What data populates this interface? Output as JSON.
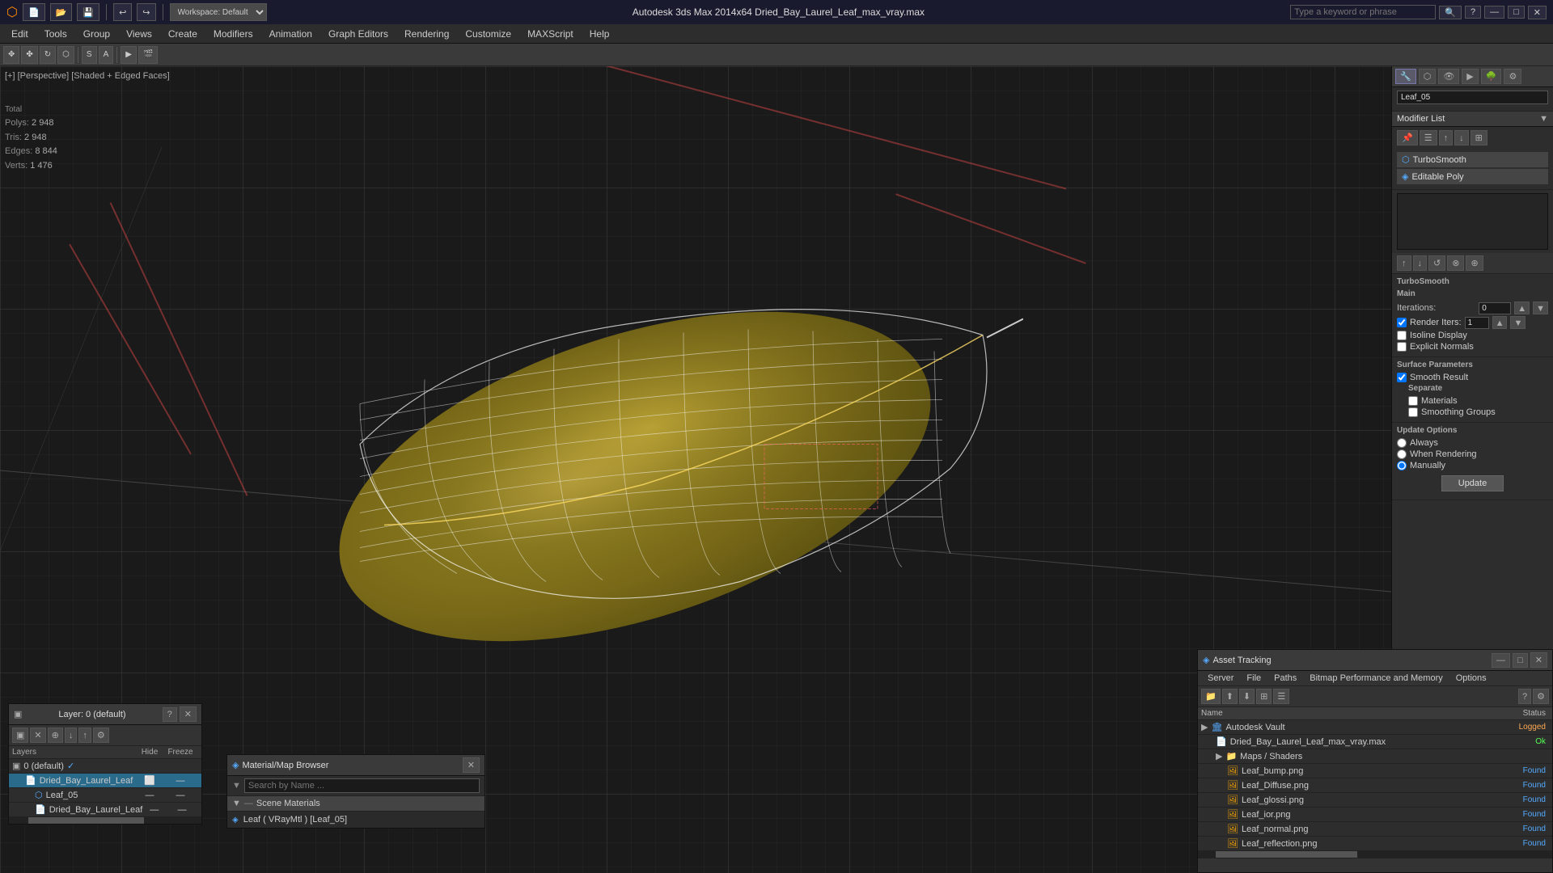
{
  "titlebar": {
    "app_icon": "3ds-max-icon",
    "workspace_label": "Workspace: Default",
    "title": "Autodesk 3ds Max 2014x64    Dried_Bay_Laurel_Leaf_max_vray.max",
    "search_placeholder": "Type a keyword or phrase",
    "min_label": "—",
    "max_label": "□",
    "close_label": "✕"
  },
  "menubar": {
    "items": [
      {
        "label": "Edit",
        "id": "edit"
      },
      {
        "label": "Tools",
        "id": "tools"
      },
      {
        "label": "Group",
        "id": "group"
      },
      {
        "label": "Views",
        "id": "views"
      },
      {
        "label": "Create",
        "id": "create"
      },
      {
        "label": "Modifiers",
        "id": "modifiers"
      },
      {
        "label": "Animation",
        "id": "animation"
      },
      {
        "label": "Graph Editors",
        "id": "graph-editors"
      },
      {
        "label": "Rendering",
        "id": "rendering"
      },
      {
        "label": "Customize",
        "id": "customize"
      },
      {
        "label": "MAXScript",
        "id": "maxscript"
      },
      {
        "label": "Help",
        "id": "help"
      }
    ]
  },
  "viewport": {
    "label": "[+] [Perspective] [Shaded + Edged Faces]",
    "stats": {
      "polys_label": "Polys:",
      "polys_total_label": "Total",
      "polys_val": "2 948",
      "tris_label": "Tris:",
      "tris_val": "2 948",
      "edges_label": "Edges:",
      "edges_val": "8 844",
      "verts_label": "Verts:",
      "verts_val": "1 476"
    }
  },
  "right_panel": {
    "object_name": "Leaf_05",
    "modifier_list_label": "Modifier List",
    "modifiers": [
      {
        "name": "TurboSmooth",
        "active": false
      },
      {
        "name": "Editable Poly",
        "active": false
      }
    ],
    "turbosmooth_label": "TurboSmooth",
    "main_label": "Main",
    "iterations_label": "Iterations:",
    "iterations_val": "0",
    "render_iters_label": "Render Iters:",
    "render_iters_val": "1",
    "isoline_display_label": "Isoline Display",
    "explicit_normals_label": "Explicit Normals",
    "surface_params_label": "Surface Parameters",
    "smooth_result_label": "Smooth Result",
    "separate_label": "Separate",
    "materials_label": "Materials",
    "smoothing_groups_label": "Smoothing Groups",
    "update_options_label": "Update Options",
    "always_label": "Always",
    "when_rendering_label": "When Rendering",
    "manually_label": "Manually",
    "update_btn_label": "Update",
    "icons": {
      "pin": "📌",
      "list": "☰",
      "func1": "↕",
      "func2": "⚙",
      "func3": "⊞"
    }
  },
  "layer_panel": {
    "title": "Layer: 0 (default)",
    "help_icon": "?",
    "close_icon": "✕",
    "columns": {
      "layers_label": "Layers",
      "hide_label": "Hide",
      "freeze_label": "Freeze"
    },
    "rows": [
      {
        "name": "0 (default)",
        "level": 0,
        "selected": false,
        "checkmark": "✓"
      },
      {
        "name": "Dried_Bay_Laurel_Leaf",
        "level": 1,
        "selected": true,
        "checkmark": ""
      },
      {
        "name": "Leaf_05",
        "level": 2,
        "selected": false,
        "checkmark": ""
      },
      {
        "name": "Dried_Bay_Laurel_Leaf",
        "level": 2,
        "selected": false,
        "checkmark": ""
      }
    ]
  },
  "mat_browser": {
    "title": "Material/Map Browser",
    "close_icon": "✕",
    "search_placeholder": "Search by Name ...",
    "scene_materials_label": "Scene Materials",
    "materials": [
      {
        "name": "Leaf ( VRayMtl ) [Leaf_05]",
        "icon": "mat-icon"
      }
    ]
  },
  "asset_tracking": {
    "title": "Asset Tracking",
    "min_icon": "—",
    "restore_icon": "□",
    "close_icon": "✕",
    "menu_items": [
      {
        "label": "Server"
      },
      {
        "label": "File"
      },
      {
        "label": "Paths"
      },
      {
        "label": "Bitmap Performance and Memory"
      }
    ],
    "options_label": "Options",
    "toolbar_icons": [
      "📁",
      "⬆",
      "⬇",
      "🔍",
      "⊞"
    ],
    "columns": {
      "name_label": "Name",
      "status_label": "Status"
    },
    "rows": [
      {
        "name": "Autodesk Vault",
        "level": 0,
        "status": "Logged",
        "status_class": "status-logged",
        "is_group": true
      },
      {
        "name": "Dried_Bay_Laurel_Leaf_max_vray.max",
        "level": 1,
        "status": "Ok",
        "status_class": "status-ok",
        "icon": "file-icon"
      },
      {
        "name": "Maps / Shaders",
        "level": 1,
        "status": "",
        "status_class": "",
        "is_group": true
      },
      {
        "name": "Leaf_bump.png",
        "level": 2,
        "status": "Found",
        "status_class": "status-found",
        "icon": "image-icon"
      },
      {
        "name": "Leaf_Diffuse.png",
        "level": 2,
        "status": "Found",
        "status_class": "status-found",
        "icon": "image-icon"
      },
      {
        "name": "Leaf_glossi.png",
        "level": 2,
        "status": "Found",
        "status_class": "status-found",
        "icon": "image-icon"
      },
      {
        "name": "Leaf_ior.png",
        "level": 2,
        "status": "Found",
        "status_class": "status-found",
        "icon": "image-icon"
      },
      {
        "name": "Leaf_normal.png",
        "level": 2,
        "status": "Found",
        "status_class": "status-found",
        "icon": "image-icon"
      },
      {
        "name": "Leaf_reflection.png",
        "level": 2,
        "status": "Found",
        "status_class": "status-found",
        "icon": "image-icon"
      }
    ]
  }
}
